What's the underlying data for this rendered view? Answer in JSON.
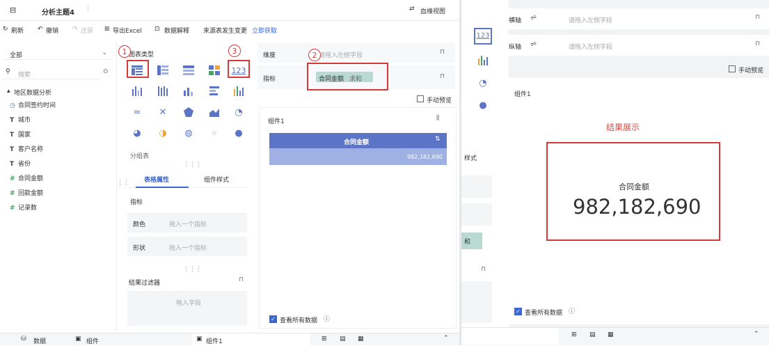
{
  "topbar": {
    "title": "分析主题4",
    "more": "⋮",
    "switch_label": "血缘视图"
  },
  "toolbar": {
    "refresh": "刷新",
    "undo": "撤销",
    "redo": "还原",
    "export": "导出Excel",
    "explain": "数据解释",
    "msg": "来源表发生变更",
    "msg_link": "立即获取"
  },
  "sidebar": {
    "scope": "全部",
    "search_placeholder": "搜索",
    "group": "地区数据分析",
    "fields": [
      {
        "icon": "clock-icon",
        "label": "合同签约时间"
      },
      {
        "icon": "text-icon",
        "label": "城市"
      },
      {
        "icon": "text-icon",
        "label": "国家"
      },
      {
        "icon": "text-icon",
        "label": "客户名称"
      },
      {
        "icon": "text-icon",
        "label": "省份"
      },
      {
        "icon": "hash-icon",
        "label": "合同金额"
      },
      {
        "icon": "hash-icon",
        "label": "回款金额"
      },
      {
        "icon": "hash-icon",
        "label": "记录数"
      }
    ]
  },
  "chart_panel": {
    "title": "图表类型",
    "group_table": "分组表",
    "tabs": [
      "表格属性",
      "组件样式"
    ],
    "metric_label": "指标",
    "color_label": "颜色",
    "color_placeholder": "拖入一个指标",
    "shape_label": "形状",
    "shape_placeholder": "拖入一个指标",
    "filter_label": "结果过滤器",
    "filter_placeholder": "拖入字段",
    "kpi_icon_label": "123"
  },
  "config": {
    "dim_label": "维度",
    "dim_placeholder": "请拖入左侧字段",
    "metric_label": "指标",
    "metric_field": "合同金额",
    "metric_agg": "求和",
    "preview_label": "手动预览",
    "component_title": "组件1",
    "table_header": "合同金额",
    "table_value": "982,182,690",
    "view_all": "查看所有数据"
  },
  "bottom": {
    "tab_data": "数据",
    "tab_component": "组件",
    "tab_component1": "组件1"
  },
  "annotations": {
    "a1": "1",
    "a2": "2",
    "a3": "3",
    "result": "结果展示"
  },
  "right": {
    "x_axis": "横轴",
    "y_axis": "纵轴",
    "placeholder": "请拖入左侧字段",
    "preview": "手动预览",
    "component_title": "组件1",
    "kpi_label": "合同金额",
    "kpi_value": "982,182,690",
    "view_all": "查看所有数据",
    "kpi_icon_label": "123",
    "style_tab": "样式",
    "agg_partial": "和"
  },
  "colors": {
    "accent": "#5b74c6",
    "annotation": "#d6393a",
    "result_text": "#e0453b"
  }
}
